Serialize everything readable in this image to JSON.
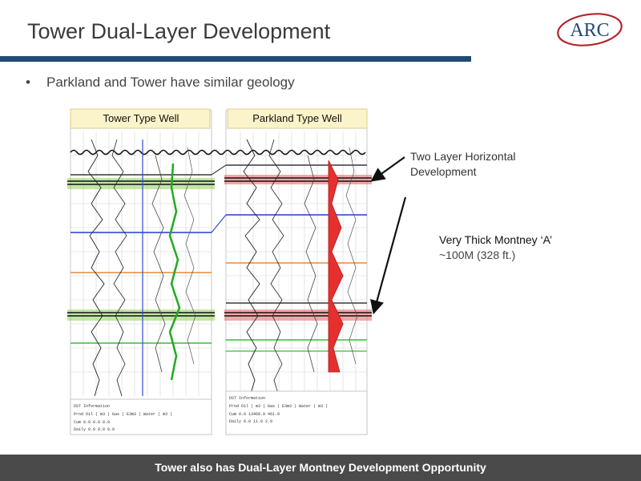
{
  "slide": {
    "title": "Tower Dual-Layer Development",
    "logo_text": "ARC",
    "bullet": "Parkland and Tower have similar geology",
    "footer": "Tower also has Dual-Layer Montney Development Opportunity"
  },
  "figure": {
    "left_panel_title": "Tower Type Well",
    "right_panel_title": "Parkland Type Well",
    "left_info_block": [
      "DST Information",
      "Prod  Oil ( m3 )  Gas ( E3m3 )  Water ( m3 )",
      "Cum       0.0         0.0          0.0",
      "Daily     0.0         0.0          0.0"
    ],
    "right_info_block": [
      "DST Information",
      "Prod  Oil ( m3 )  Gas ( E3m3 )  Water ( m3 )",
      "Cum       0.0     13468.9        461.9",
      "Daily     0.0        11.8          2.9"
    ]
  },
  "annotations": {
    "two_layer_line1": "Two Layer Horizontal",
    "two_layer_line2": "Development",
    "thick_line1": "Very Thick Montney ‘A’",
    "thick_line2": "~100M (328 ft.)"
  },
  "colors": {
    "header_rule": "#1f4a73",
    "footer_bg": "#4a4a4a",
    "logo_red": "#b5242d",
    "logo_blue": "#1f4a73",
    "marker_green": "#8fd35a",
    "marker_red": "#e86060",
    "blue_horizon": "#1d3fd1",
    "orange_horizon": "#e8883a",
    "green_horizon": "#35c035"
  }
}
